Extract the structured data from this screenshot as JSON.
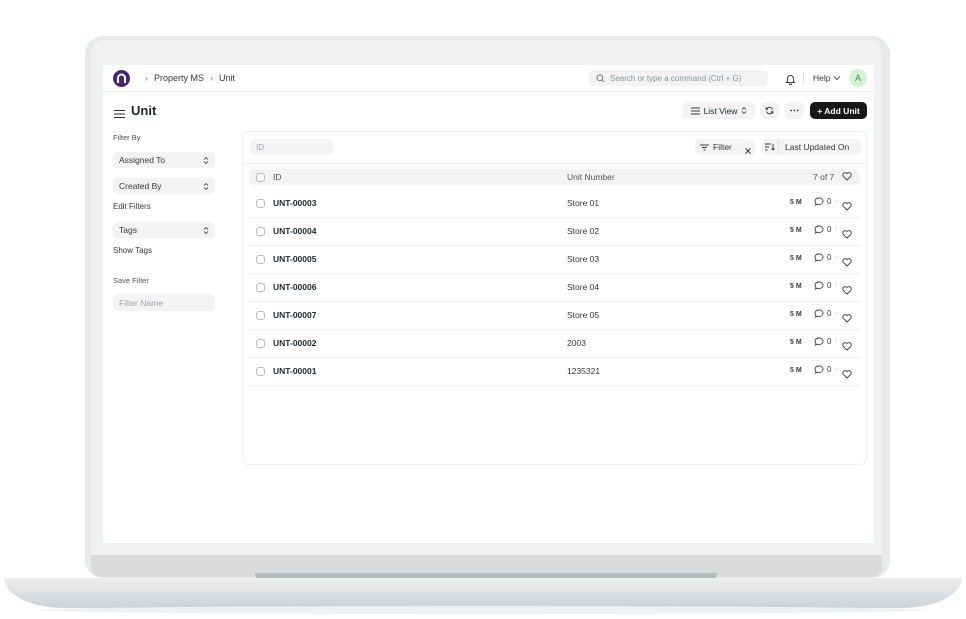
{
  "navbar": {
    "breadcrumbs": [
      "Property MS",
      "Unit"
    ],
    "search_placeholder": "Search or type a command (Ctrl + G)",
    "help_label": "Help",
    "avatar_initial": "A"
  },
  "page": {
    "title": "Unit",
    "list_view_label": "List View",
    "add_button_label": "+ Add Unit"
  },
  "sidebar": {
    "filter_by_label": "Filter By",
    "assigned_to_label": "Assigned To",
    "created_by_label": "Created By",
    "edit_filters_label": "Edit Filters",
    "tags_label": "Tags",
    "show_tags_label": "Show Tags",
    "save_filter_label": "Save Filter",
    "filter_name_placeholder": "Filter Name"
  },
  "list": {
    "id_placeholder": "ID",
    "filter_label": "Filter",
    "sort_label": "Last Updated On",
    "columns": [
      "ID",
      "Unit Number"
    ],
    "count_label": "7 of 7",
    "rows": [
      {
        "id": "UNT-00003",
        "unit_number": "Store 01",
        "modified": "5 M",
        "comments": "0"
      },
      {
        "id": "UNT-00004",
        "unit_number": "Store 02",
        "modified": "5 M",
        "comments": "0"
      },
      {
        "id": "UNT-00005",
        "unit_number": "Store 03",
        "modified": "5 M",
        "comments": "0"
      },
      {
        "id": "UNT-00006",
        "unit_number": "Store 04",
        "modified": "5 M",
        "comments": "0"
      },
      {
        "id": "UNT-00007",
        "unit_number": "Store 05",
        "modified": "5 M",
        "comments": "0"
      },
      {
        "id": "UNT-00002",
        "unit_number": "2003",
        "modified": "5 M",
        "comments": "0"
      },
      {
        "id": "UNT-00001",
        "unit_number": "1235321",
        "modified": "5 M",
        "comments": "0"
      }
    ]
  },
  "colors": {
    "logo": "#4a2576",
    "primary_button": "#171717",
    "avatar_bg": "#d8f2da",
    "control_bg": "#f3f3f3"
  },
  "icons": [
    "app-logo-icon",
    "search-icon",
    "bell-icon",
    "chevron-down-icon",
    "menu-icon",
    "list-icon",
    "refresh-icon",
    "more-icon",
    "filter-icon",
    "close-icon",
    "sort-icon",
    "comment-icon",
    "heart-icon"
  ]
}
